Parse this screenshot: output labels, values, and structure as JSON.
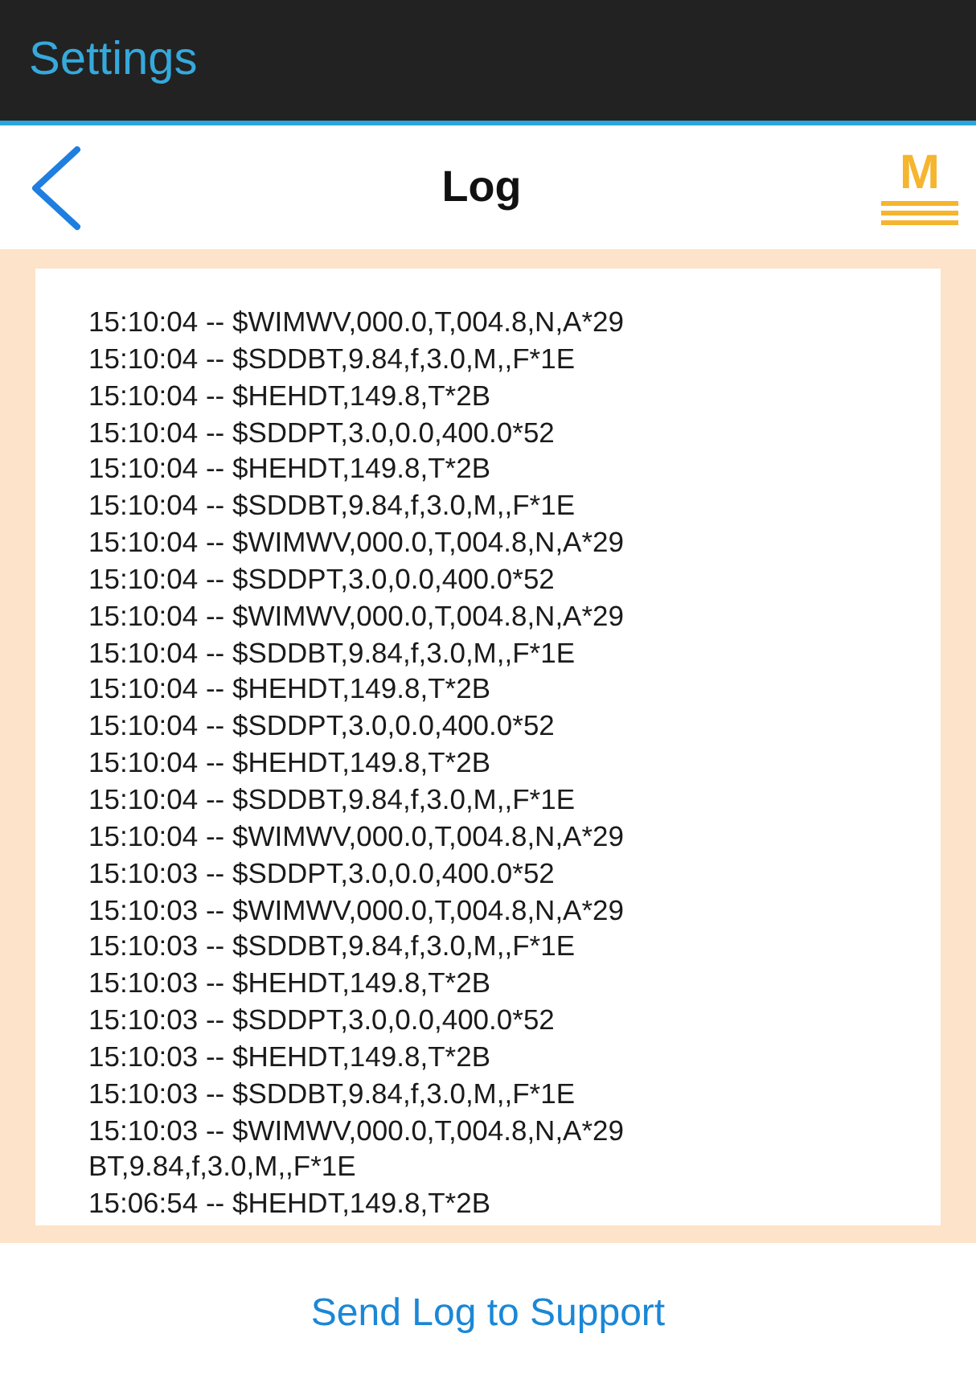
{
  "app_bar": {
    "title": "Settings"
  },
  "nav_bar": {
    "title": "Log",
    "logo_letter": "M"
  },
  "log_lines": [
    "15:10:04 -- $WIMWV,000.0,T,004.8,N,A*29",
    "15:10:04 -- $SDDBT,9.84,f,3.0,M,,F*1E",
    "15:10:04 -- $HEHDT,149.8,T*2B",
    "15:10:04 -- $SDDPT,3.0,0.0,400.0*52",
    "15:10:04 -- $HEHDT,149.8,T*2B",
    "15:10:04 -- $SDDBT,9.84,f,3.0,M,,F*1E",
    "15:10:04 -- $WIMWV,000.0,T,004.8,N,A*29",
    "15:10:04 -- $SDDPT,3.0,0.0,400.0*52",
    "15:10:04 -- $WIMWV,000.0,T,004.8,N,A*29",
    "15:10:04 -- $SDDBT,9.84,f,3.0,M,,F*1E",
    "15:10:04 -- $HEHDT,149.8,T*2B",
    "15:10:04 -- $SDDPT,3.0,0.0,400.0*52",
    "15:10:04 -- $HEHDT,149.8,T*2B",
    "15:10:04 -- $SDDBT,9.84,f,3.0,M,,F*1E",
    "15:10:04 -- $WIMWV,000.0,T,004.8,N,A*29",
    "15:10:03 -- $SDDPT,3.0,0.0,400.0*52",
    "15:10:03 -- $WIMWV,000.0,T,004.8,N,A*29",
    "15:10:03 -- $SDDBT,9.84,f,3.0,M,,F*1E",
    "15:10:03 -- $HEHDT,149.8,T*2B",
    "15:10:03 -- $SDDPT,3.0,0.0,400.0*52",
    "15:10:03 -- $HEHDT,149.8,T*2B",
    "15:10:03 -- $SDDBT,9.84,f,3.0,M,,F*1E",
    "15:10:03 -- $WIMWV,000.0,T,004.8,N,A*29",
    "BT,9.84,f,3.0,M,,F*1E",
    "15:06:54 -- $HEHDT,149.8,T*2B"
  ],
  "footer": {
    "button": "Send Log to Support"
  }
}
